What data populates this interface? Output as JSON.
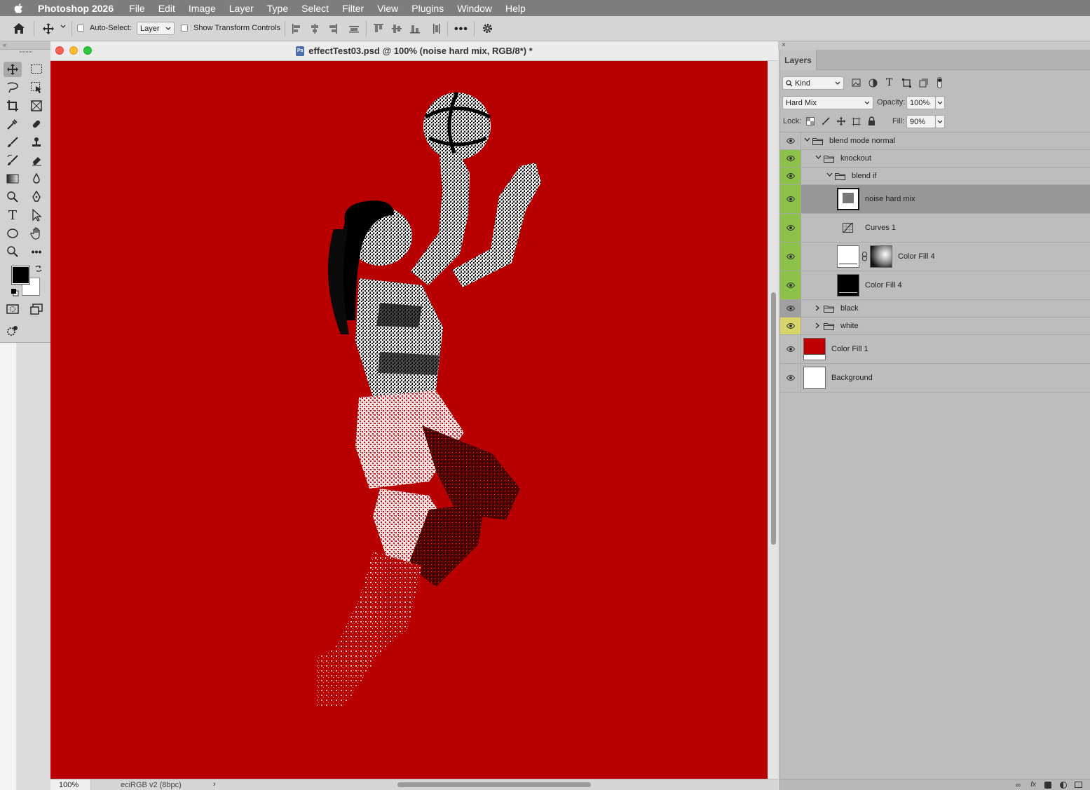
{
  "menubar": {
    "app": "Photoshop 2026",
    "items": [
      "File",
      "Edit",
      "Image",
      "Layer",
      "Type",
      "Select",
      "Filter",
      "View",
      "Plugins",
      "Window",
      "Help"
    ]
  },
  "options": {
    "auto_select_label": "Auto-Select:",
    "auto_select_value": "Layer",
    "show_transform_label": "Show Transform Controls"
  },
  "document": {
    "title": "effectTest03.psd @ 100% (noise hard mix, RGB/8*) *",
    "zoom": "100%",
    "profile": "eciRGB v2 (8bpc)",
    "canvas_color": "#b80000"
  },
  "layers_panel": {
    "tab": "Layers",
    "filter_kind": "Kind",
    "blend_mode": "Hard Mix",
    "opacity_label": "Opacity:",
    "opacity_value": "100%",
    "lock_label": "Lock:",
    "fill_label": "Fill:",
    "fill_value": "90%",
    "layers": [
      {
        "name": "blend mode normal",
        "type": "group",
        "expanded": true,
        "eye": "none"
      },
      {
        "name": "knockout",
        "type": "group",
        "expanded": true,
        "eye": "green"
      },
      {
        "name": "blend if",
        "type": "group",
        "expanded": true,
        "eye": "green"
      },
      {
        "name": "noise hard mix",
        "type": "fill",
        "eye": "green",
        "selected": true
      },
      {
        "name": "Curves 1",
        "type": "adjustment",
        "eye": "green"
      },
      {
        "name": "Color Fill 4",
        "type": "fill-masked",
        "eye": "green"
      },
      {
        "name": "Color Fill 4",
        "type": "fill-black",
        "eye": "green"
      },
      {
        "name": "black",
        "type": "group",
        "expanded": false,
        "eye": "gray"
      },
      {
        "name": "white",
        "type": "group",
        "expanded": false,
        "eye": "yellow"
      },
      {
        "name": "Color Fill 1",
        "type": "fill-red",
        "eye": "none"
      },
      {
        "name": "Background",
        "type": "background",
        "eye": "none"
      }
    ]
  }
}
